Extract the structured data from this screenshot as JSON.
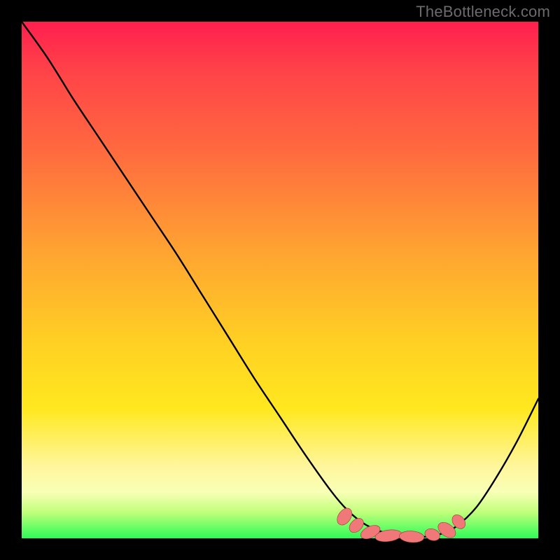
{
  "watermark": "TheBottleneck.com",
  "colors": {
    "frame": "#000000",
    "gradient_top": "#ff1f4f",
    "gradient_bottom": "#2dfc57",
    "curve": "#000000",
    "marker_fill": "#f07878",
    "marker_stroke": "#9c3a3a"
  },
  "chart_data": {
    "type": "line",
    "title": "",
    "xlabel": "",
    "ylabel": "",
    "xlim": [
      0,
      100
    ],
    "ylim": [
      0,
      100
    ],
    "grid": false,
    "legend": false,
    "series": [
      {
        "name": "curve",
        "x": [
          0,
          5,
          10,
          15,
          20,
          25,
          30,
          35,
          40,
          45,
          50,
          55,
          60,
          63,
          66,
          69,
          72,
          75,
          78,
          81,
          84,
          88,
          92,
          96,
          100
        ],
        "y": [
          100,
          93,
          85,
          77.5,
          70,
          62.5,
          55,
          47,
          39,
          31,
          23.5,
          16,
          9,
          5.5,
          3,
          1.5,
          0.7,
          0.3,
          0.3,
          0.8,
          2.2,
          6,
          12,
          19,
          27
        ]
      }
    ],
    "markers": [
      {
        "x": 62.5,
        "y": 4.2,
        "rx": 1.8,
        "ry": 1.2,
        "angle": -55
      },
      {
        "x": 64.8,
        "y": 2.5,
        "rx": 1.6,
        "ry": 1.1,
        "angle": -45
      },
      {
        "x": 67.5,
        "y": 1.2,
        "rx": 2.0,
        "ry": 1.1,
        "angle": -25
      },
      {
        "x": 71.0,
        "y": 0.5,
        "rx": 2.6,
        "ry": 1.1,
        "angle": -8
      },
      {
        "x": 75.5,
        "y": 0.3,
        "rx": 2.4,
        "ry": 1.1,
        "angle": 4
      },
      {
        "x": 79.5,
        "y": 0.7,
        "rx": 1.5,
        "ry": 1.1,
        "angle": 20
      },
      {
        "x": 82.3,
        "y": 1.6,
        "rx": 1.9,
        "ry": 1.2,
        "angle": 35
      },
      {
        "x": 84.6,
        "y": 3.2,
        "rx": 1.5,
        "ry": 1.1,
        "angle": 50
      }
    ]
  }
}
